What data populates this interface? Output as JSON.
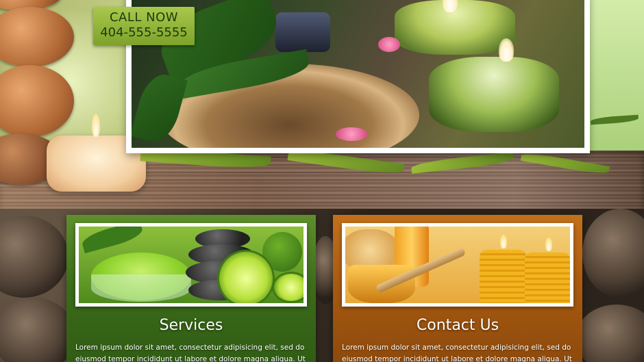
{
  "header": {
    "call_label": "CALL NOW",
    "phone": "404-555-5555"
  },
  "cards": [
    {
      "title": "Services",
      "text": "Lorem ipsum dolor sit amet, consectetur adipisicing elit, sed do eiusmod tempor incididunt ut labore et dolore magna aliqua. Ut enim",
      "accent": "#4f7f22"
    },
    {
      "title": "Contact Us",
      "text": "Lorem ipsum dolor sit amet, consectetur adipisicing elit, sed do eiusmod tempor incididunt ut labore et dolore magna aliqua. Ut enim",
      "accent": "#b5640f"
    }
  ],
  "colors": {
    "badge": "#98ba40",
    "services_card": "#4f7f22",
    "contact_card": "#b5640f"
  }
}
